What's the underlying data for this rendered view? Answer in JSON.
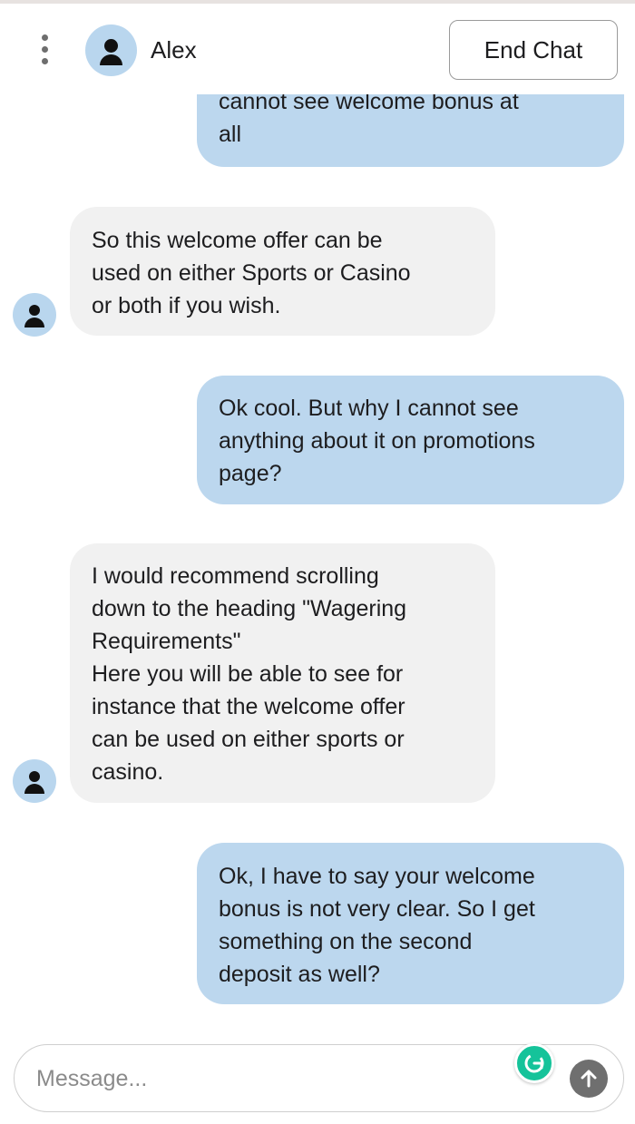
{
  "header": {
    "agent_name": "Alex",
    "end_chat_label": "End Chat"
  },
  "messages": [
    {
      "sender": "user",
      "text": "cannot see welcome bonus at\nall"
    },
    {
      "sender": "agent",
      "text": "So this welcome offer can be\nused on either Sports or Casino\nor both if you wish."
    },
    {
      "sender": "user",
      "text": "Ok cool. But why I cannot see\nanything about it on promotions\npage?"
    },
    {
      "sender": "agent",
      "text": "I would recommend scrolling\ndown to the heading \"Wagering\nRequirements\"\nHere you will be able to see for\ninstance that the welcome offer\ncan be used on either sports or\ncasino."
    },
    {
      "sender": "user",
      "text": "Ok, I have to say your welcome\nbonus is not very clear. So I get\nsomething on the second\ndeposit as well?"
    }
  ],
  "composer": {
    "placeholder": "Message...",
    "value": ""
  },
  "icons": {
    "menu": "kebab-menu-icon",
    "avatar": "person-avatar-icon",
    "grammarly": "grammarly-icon",
    "send": "arrow-up-send-icon"
  },
  "colors": {
    "user_bubble": "#bcd7ee",
    "agent_bubble": "#f1f1f1",
    "avatar_bg": "#b9d6ee",
    "grammarly": "#15c39a",
    "send_button": "#6f6f6f"
  }
}
